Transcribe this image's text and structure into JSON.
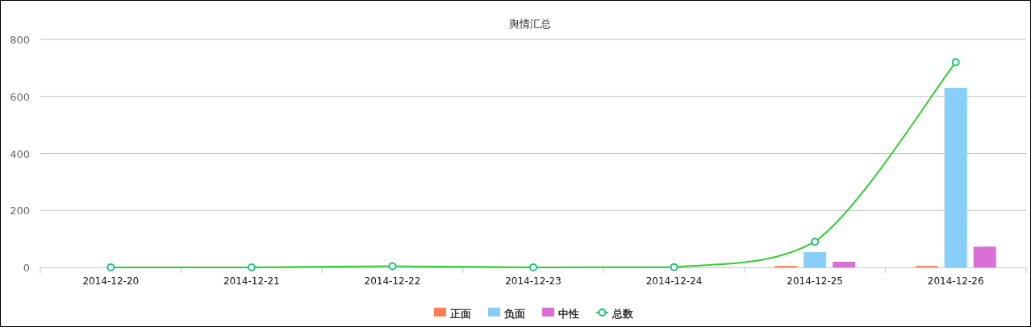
{
  "chart_data": {
    "type": "bar",
    "title": "舆情汇总",
    "categories": [
      "2014-12-20",
      "2014-12-21",
      "2014-12-22",
      "2014-12-23",
      "2014-12-24",
      "2014-12-25",
      "2014-12-26"
    ],
    "ylim": [
      0,
      800
    ],
    "yticks": [
      0,
      200,
      400,
      600,
      800
    ],
    "stacked": false,
    "grid": true,
    "legend": true,
    "series": [
      {
        "name": "正面",
        "type": "bar",
        "color": "#ff7f50",
        "values": [
          0,
          0,
          0,
          0,
          0,
          5,
          5
        ]
      },
      {
        "name": "负面",
        "type": "bar",
        "color": "#87cefa",
        "values": [
          0,
          0,
          0,
          0,
          0,
          54,
          630
        ]
      },
      {
        "name": "中性",
        "type": "bar",
        "color": "#da70d6",
        "values": [
          0,
          0,
          0,
          0,
          0,
          20,
          73
        ]
      },
      {
        "name": "总数",
        "type": "line",
        "color": "#32cd32",
        "marker": "circle",
        "values": [
          0,
          0,
          4,
          0,
          1,
          90,
          720
        ]
      }
    ]
  }
}
